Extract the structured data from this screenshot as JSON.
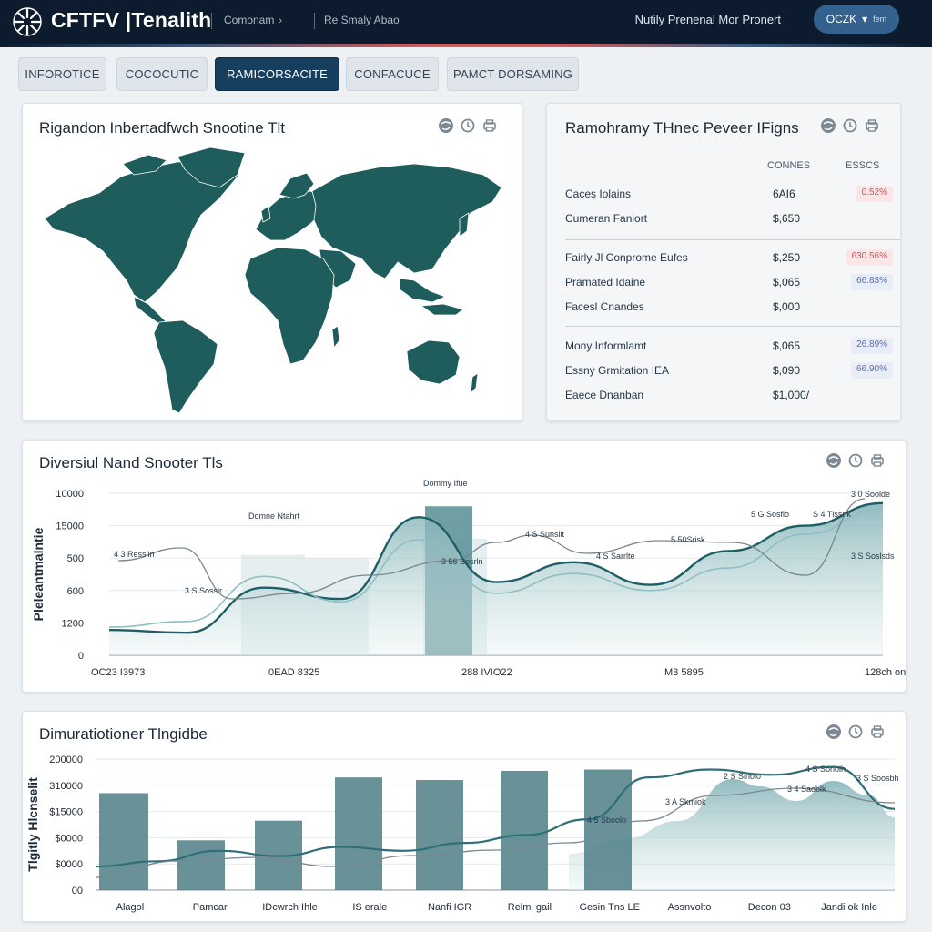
{
  "header": {
    "app_title": "CFTFV |Tenalith",
    "nav": [
      {
        "label": "Comonam"
      },
      {
        "label": "Re Smaly Abao"
      }
    ],
    "notify": "Nutily Prenenal  Mor Pronert",
    "account_label": "OCZK",
    "account_sub": "fem",
    "accent_color": "#163f5f"
  },
  "tabs": [
    {
      "label": "INFOROTICE"
    },
    {
      "label": "COCOCUTIC"
    },
    {
      "label": "RAMICORSACITE"
    },
    {
      "label": "CONFACUCE"
    },
    {
      "label": "PAMCT DORSAMING"
    }
  ],
  "map_panel": {
    "title": "Rigandon Inbertadfwch Snootine Tlt",
    "icons": [
      "globe-icon",
      "clock-icon",
      "print-icon"
    ]
  },
  "summary_panel": {
    "title": "Ramohramy THnec Peveer IFigns",
    "col_headers": [
      "CONNES",
      "ESSCS"
    ],
    "groups": [
      [
        {
          "label": "Caces Iolains",
          "value": "6AI6",
          "change": "0.52%",
          "tone": "neg"
        },
        {
          "label": "Cumeran Faniort",
          "value": "$,650",
          "change": "",
          "tone": ""
        }
      ],
      [
        {
          "label": "Fairly Jl Conprome Eufes",
          "value": "$,250",
          "change": "630.56%",
          "tone": "neg"
        },
        {
          "label": "Pramated Idaine",
          "value": "$,065",
          "change": "66.83%",
          "tone": "pos"
        },
        {
          "label": "Facesl Cnandes",
          "value": "$,000",
          "change": "",
          "tone": ""
        }
      ],
      [
        {
          "label": "Mony Informlamt",
          "value": "$,065",
          "change": "26.89%",
          "tone": "pos"
        },
        {
          "label": "Essny Grmitation IEA",
          "value": "$,090",
          "change": "66.90%",
          "tone": "pos"
        },
        {
          "label": "Eaece Dnanban",
          "value": "$1,000/",
          "change": "",
          "tone": ""
        }
      ]
    ]
  },
  "chart_data": [
    {
      "type": "area",
      "title": "Diversiul Nand Snooter Tls",
      "ylabel": "Pleleantmalntie",
      "y_tick_labels": [
        "10000",
        "15000",
        "500",
        "600",
        "1200",
        "0"
      ],
      "x_tick_labels": [
        "OC23 I3973",
        "0EAD 8325",
        "288 IVIO22",
        "M3 5895",
        "128ch ond"
      ],
      "categories": [
        "OC23 I3973",
        "0EAD 8325",
        "288 IVIO22",
        "M3 5895",
        "128ch ond"
      ],
      "series": [
        {
          "name": "",
          "values": [
            18,
            16,
            48,
            40,
            98,
            52,
            66,
            50,
            74,
            92,
            108
          ]
        },
        {
          "name": "",
          "values": [
            20,
            24,
            56,
            38,
            82,
            44,
            58,
            46,
            62,
            86,
            104
          ]
        }
      ],
      "bars": [
        62,
        60,
        72,
        92
      ],
      "annotations": [
        "Dommy Ifue",
        "Domne Ntahrt",
        "3 S Sosslr",
        "4 3 Resslin",
        "3 56 Sosrln",
        "4 S Sunslit",
        "4 S Sarrlte",
        "5 50Srisk",
        "5 G Sosfio",
        "S 4 Tlssnk",
        "3 S Soslsds",
        "3 0 Soolde"
      ],
      "grid": true,
      "colors": [
        "#1d5f68",
        "#8fbfc2",
        "#2e6f78"
      ]
    },
    {
      "type": "bar",
      "title": "Dimuratiotioner Tlngidbe",
      "ylabel": "Tlgitly Hlcnselit",
      "y_tick_labels": [
        "200000",
        "310000",
        "$15000",
        "$0000",
        "$0000",
        "00"
      ],
      "categories": [
        "Alagol",
        "Pamcar",
        "IDcwrch Ihle",
        "IS erale",
        "Nanfi IGR",
        "Relmi gail",
        "Gesin Tns LE",
        "Assnvolto",
        "Decon 03",
        "Jandi ok Inle"
      ],
      "values": [
        0.74,
        0.38,
        0.53,
        0.86,
        0.84,
        0.91,
        0.92
      ],
      "line_values": [
        0.18,
        0.22,
        0.3,
        0.26,
        0.33,
        0.3,
        0.36,
        0.42,
        0.54,
        0.86,
        0.92,
        0.88,
        0.94,
        0.62
      ],
      "annotations": [
        "3 A Skmiok",
        "2 S Sinolo",
        "3 4 Saoblk",
        "4 S Sonolh",
        "3 S Soosbh",
        "4 5 Sboolo"
      ],
      "grid": true,
      "colors": [
        "#4e7f86",
        "#8fbfc2",
        "#2e6f78"
      ]
    }
  ]
}
